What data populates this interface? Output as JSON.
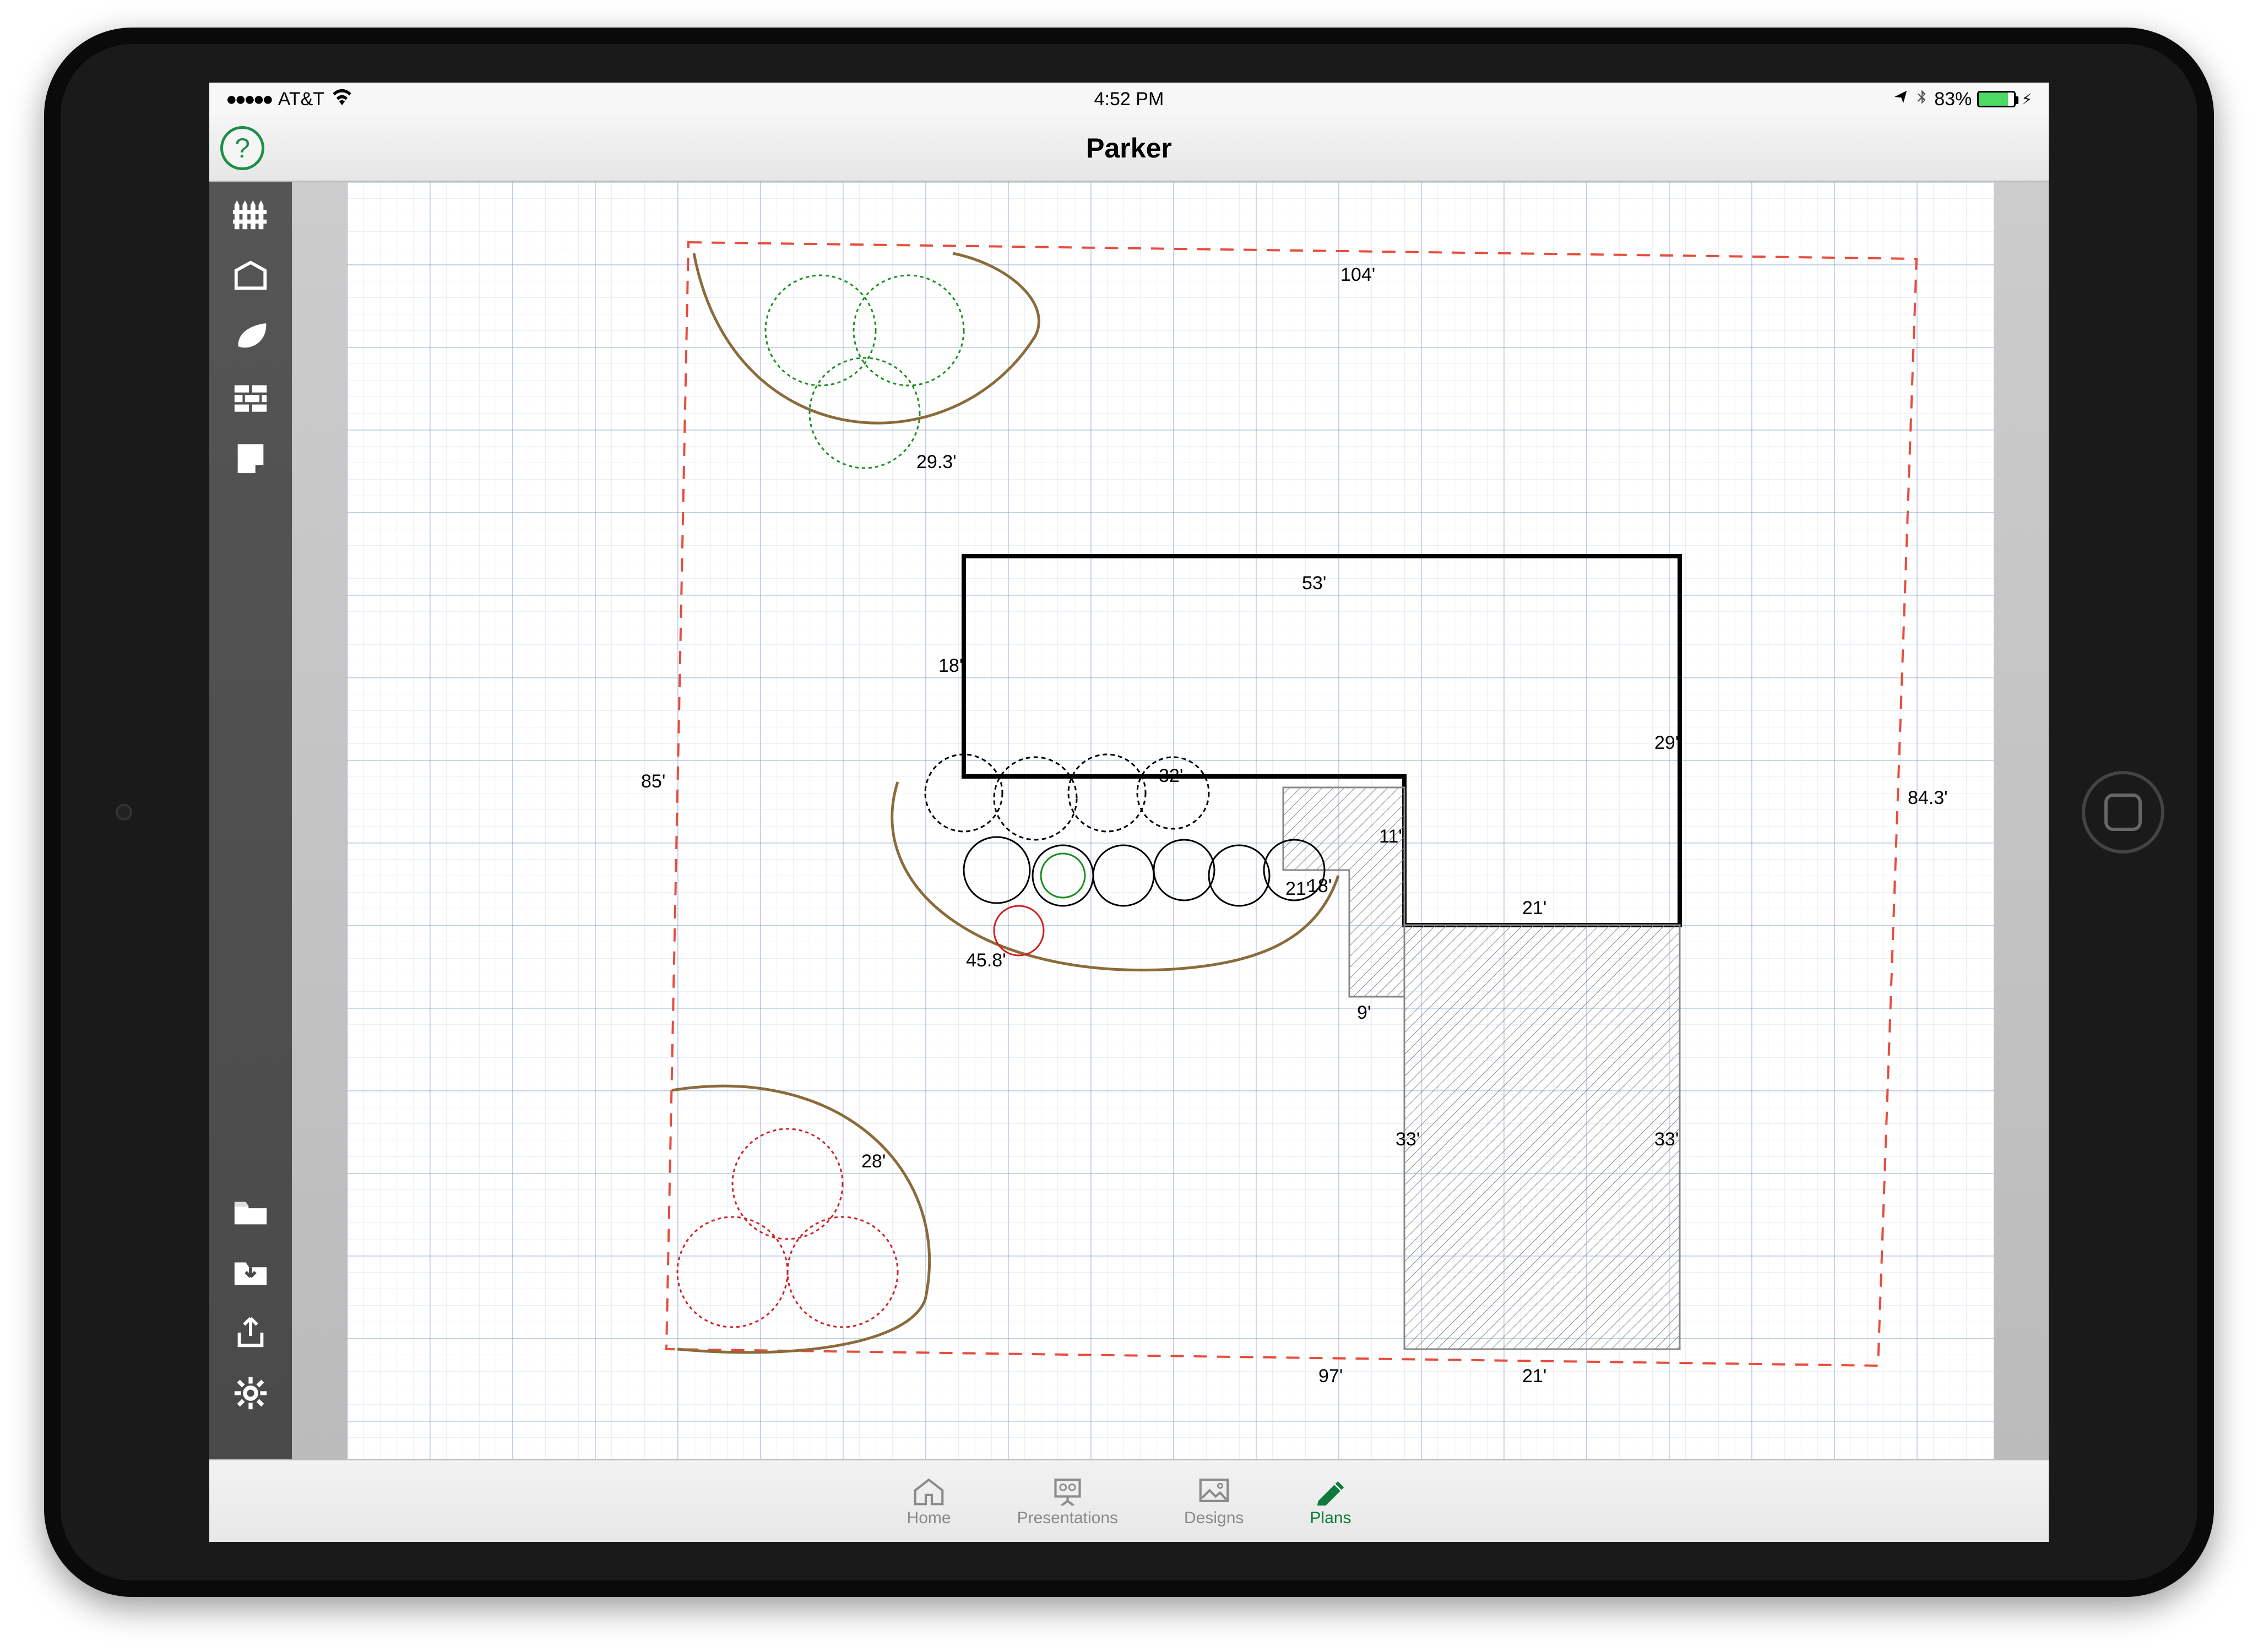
{
  "status": {
    "signal_dots": "●●●●●",
    "carrier": "AT&T",
    "time": "4:52 PM",
    "battery_pct": "83%"
  },
  "title": "Parker",
  "help_label": "?",
  "sidebar_tools": {
    "fence": "fence-tool",
    "house": "house-shape-tool",
    "leaf": "plant-tool",
    "brick": "hardscape-tool",
    "notes": "notes-tool",
    "folder": "open-file",
    "save": "save-file",
    "share": "share",
    "settings": "settings"
  },
  "tabs": {
    "home": "Home",
    "presentations": "Presentations",
    "designs": "Designs",
    "plans": "Plans"
  },
  "dims": {
    "d104": "104'",
    "d29_3": "29.3'",
    "d53": "53'",
    "d18a": "18'",
    "d85": "85'",
    "d84_3": "84.3'",
    "d29": "29'",
    "d32": "32'",
    "d11": "11'",
    "d18b": "18'",
    "d21a": "21'",
    "d21b": "21'",
    "d21c": "21'",
    "d45_8": "45.8'",
    "d9": "9'",
    "d33a": "33'",
    "d33b": "33'",
    "d28": "28'",
    "d97": "97'"
  }
}
